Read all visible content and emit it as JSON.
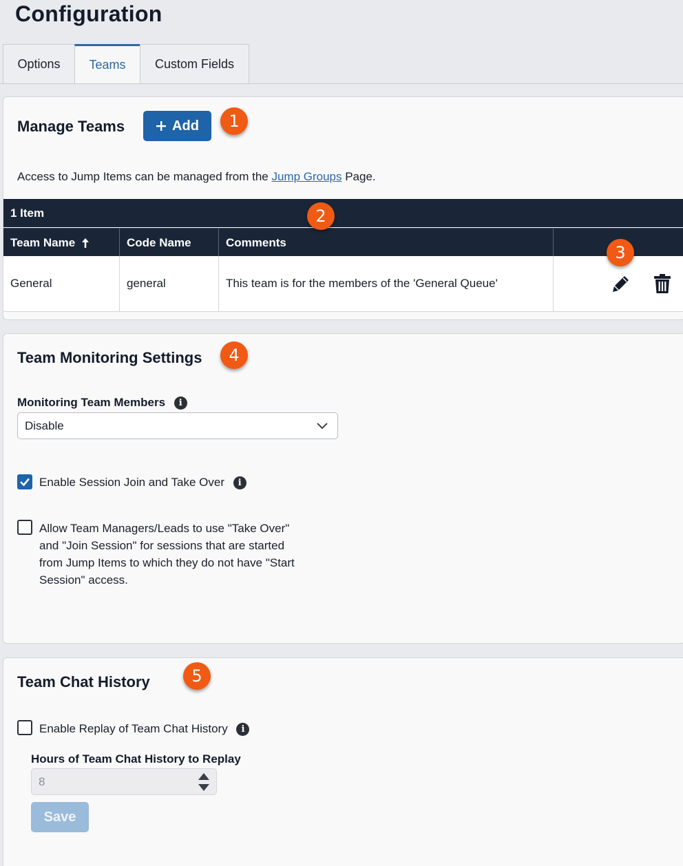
{
  "page_title": "Configuration",
  "tabs": [
    {
      "label": "Options"
    },
    {
      "label": "Teams",
      "active": true
    },
    {
      "label": "Custom Fields"
    }
  ],
  "manage_teams": {
    "title": "Manage Teams",
    "add_label": "Add",
    "info_prefix": "Access to Jump Items can be managed from the ",
    "info_link": "Jump Groups",
    "info_suffix": " Page.",
    "item_count": "1 Item",
    "columns": [
      "Team Name",
      "Code Name",
      "Comments",
      ""
    ],
    "rows": [
      {
        "team_name": "General",
        "code_name": "general",
        "comments": "This team is for the members of the 'General Queue'"
      }
    ]
  },
  "monitoring": {
    "title": "Team Monitoring Settings",
    "field_label": "Monitoring Team Members",
    "select_value": "Disable",
    "join_takeover_label": "Enable Session Join and Take Over",
    "join_takeover_checked": true,
    "allow_leads_lines": [
      "Allow Team Managers/Leads to use \"Take Over\"",
      "and \"Join Session\" for sessions that are started",
      "from Jump Items to which they do not have \"Start",
      "Session\" access."
    ],
    "allow_leads_checked": false
  },
  "chat_history": {
    "title": "Team Chat History",
    "replay_label": "Enable Replay of Team Chat History",
    "replay_checked": false,
    "hours_label": "Hours of Team Chat History to Replay",
    "hours_value": "8",
    "save_label": "Save"
  },
  "badges": [
    "1",
    "2",
    "3",
    "4",
    "5"
  ],
  "colors": {
    "accent": "#1f63a8",
    "badge": "#f05a14",
    "table_header": "#1a2637"
  }
}
